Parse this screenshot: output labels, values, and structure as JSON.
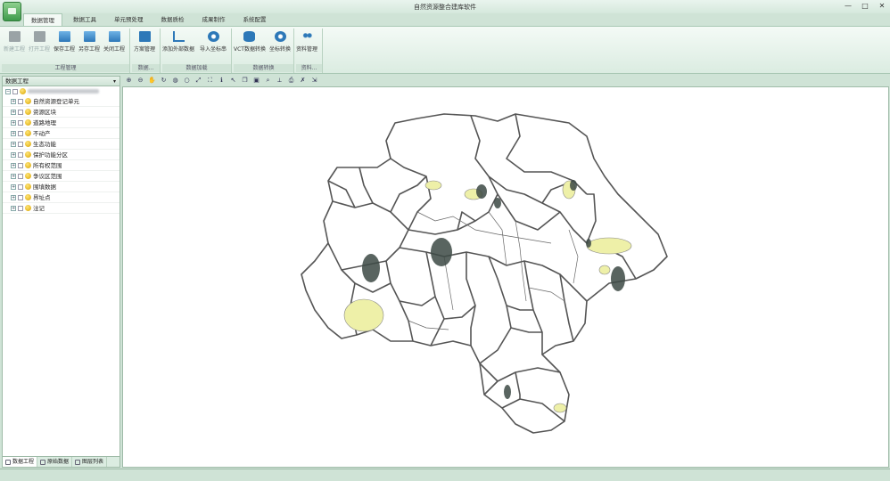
{
  "window": {
    "title": "自然资源整合建库软件",
    "controls": [
      "—",
      "□",
      "✕"
    ]
  },
  "tabs": [
    "数据管理",
    "数据工具",
    "单元预处理",
    "数据质检",
    "成果制作",
    "系统配置"
  ],
  "ribbon": {
    "groups": [
      {
        "label": "工程管理",
        "buttons": [
          "新建工程",
          "打开工程",
          "保存工程",
          "另存工程",
          "关闭工程"
        ]
      },
      {
        "label": "数据...",
        "buttons": [
          "方案管理"
        ]
      },
      {
        "label": "数据加载",
        "buttons": [
          "添加外部数据",
          "导入坐标串"
        ]
      },
      {
        "label": "数据转换",
        "buttons": [
          "VCT数据转换",
          "坐标转换"
        ]
      },
      {
        "label": "资料...",
        "buttons": [
          "资料管理"
        ]
      }
    ]
  },
  "panel": {
    "title": "数据工程",
    "layers": [
      "自然资源登记单元",
      "资源区块",
      "道路地理",
      "不动产",
      "生态功能",
      "保护功能分区",
      "所有权范围",
      "争议区范围",
      "围填数据",
      "界址点",
      "注记"
    ],
    "bottom_tabs": [
      "数据工程",
      "原始数据",
      "图层列表"
    ]
  },
  "map_toolbar": [
    "zoom-in",
    "zoom-out",
    "pan",
    "refresh",
    "globe",
    "circle",
    "full-extent",
    "extent",
    "info",
    "select",
    "copy",
    "paste",
    "find",
    "measure",
    "print",
    "clear",
    "export"
  ],
  "colors": {
    "chrome": "#cfe3d6",
    "boundary": "#555555",
    "fill_yellow": "#eef0a8",
    "fill_dark": "#3d4a45"
  }
}
